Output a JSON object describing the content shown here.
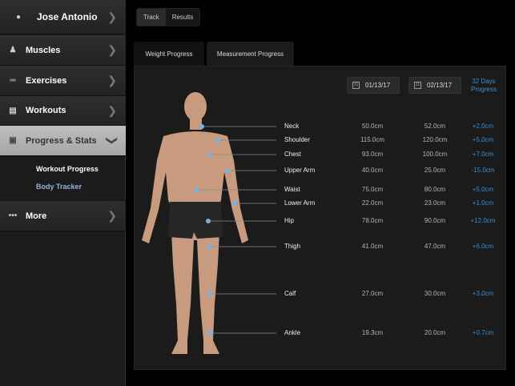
{
  "sidebar": {
    "user": "Jose Antonio",
    "items": [
      {
        "label": "Muscles",
        "icon": "muscle-figure-icon"
      },
      {
        "label": "Exercises",
        "icon": "dumbbell-icon"
      },
      {
        "label": "Workouts",
        "icon": "workout-card-icon"
      },
      {
        "label": "Progress & Stats",
        "icon": "calendar-icon",
        "active": true
      },
      {
        "label": "More",
        "icon": "dots-icon"
      }
    ],
    "submenu": [
      {
        "label": "Workout Progress"
      },
      {
        "label": "Body Tracker",
        "active": true
      }
    ]
  },
  "segment": {
    "track": "Track",
    "results": "Results",
    "selected": "Track"
  },
  "tabs": [
    {
      "label": "Weight Progress"
    },
    {
      "label": "Measurement Progress",
      "active": true
    }
  ],
  "dates": {
    "start": "01/13/17",
    "end": "02/13/17",
    "days_line1": "32 Days",
    "days_line2": "Progress"
  },
  "colors": {
    "accent": "#3a8fd0",
    "highlight": "#b3b3b3"
  },
  "measurements": [
    {
      "name": "Neck",
      "start": "50.0cm",
      "end": "52.0cm",
      "diff": "+2.0cm"
    },
    {
      "name": "Shoulder",
      "start": "115.0cm",
      "end": "120.0cm",
      "diff": "+5.0cm"
    },
    {
      "name": "Chest",
      "start": "93.0cm",
      "end": "100.0cm",
      "diff": "+7.0cm"
    },
    {
      "name": "Upper Arm",
      "start": "40.0cm",
      "end": "25.0cm",
      "diff": "-15.0cm"
    },
    {
      "name": "Waist",
      "start": "75.0cm",
      "end": "80.0cm",
      "diff": "+5.0cm"
    },
    {
      "name": "Lower Arm",
      "start": "22.0cm",
      "end": "23.0cm",
      "diff": "+1.0cm"
    },
    {
      "name": "Hip",
      "start": "78.0cm",
      "end": "90.0cm",
      "diff": "+12.0cm"
    },
    {
      "name": "Thigh",
      "start": "41.0cm",
      "end": "47.0cm",
      "diff": "+6.0cm"
    },
    {
      "name": "Calf",
      "start": "27.0cm",
      "end": "30.0cm",
      "diff": "+3.0cm"
    },
    {
      "name": "Ankle",
      "start": "19.3cm",
      "end": "20.0cm",
      "diff": "+0.7cm"
    }
  ]
}
